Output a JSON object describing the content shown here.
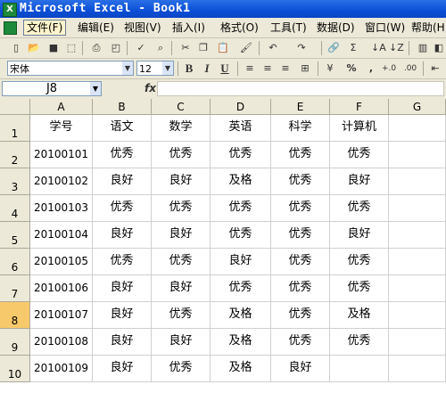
{
  "window": {
    "title": "Microsoft Excel - Book1"
  },
  "menu": [
    "文件(F)",
    "编辑(E)",
    "视图(V)",
    "插入(I)",
    "格式(O)",
    "工具(T)",
    "数据(D)",
    "窗口(W)",
    "帮助(H)"
  ],
  "format_toolbar": {
    "font": "宋体",
    "size": "12",
    "percent": "%",
    "comma": ","
  },
  "formula_bar": {
    "name_box": "J8",
    "fx": "fx",
    "content": ""
  },
  "columns": [
    "A",
    "B",
    "C",
    "D",
    "E",
    "F",
    "G"
  ],
  "selected_row": "8",
  "rows": [
    {
      "num": "1",
      "cells": [
        "学号",
        "语文",
        "数学",
        "英语",
        "科学",
        "计算机",
        ""
      ]
    },
    {
      "num": "2",
      "cells": [
        "20100101",
        "优秀",
        "优秀",
        "优秀",
        "优秀",
        "优秀",
        ""
      ]
    },
    {
      "num": "3",
      "cells": [
        "20100102",
        "良好",
        "良好",
        "及格",
        "优秀",
        "良好",
        ""
      ]
    },
    {
      "num": "4",
      "cells": [
        "20100103",
        "优秀",
        "优秀",
        "优秀",
        "优秀",
        "优秀",
        ""
      ]
    },
    {
      "num": "5",
      "cells": [
        "20100104",
        "良好",
        "良好",
        "优秀",
        "优秀",
        "良好",
        ""
      ]
    },
    {
      "num": "6",
      "cells": [
        "20100105",
        "优秀",
        "优秀",
        "良好",
        "优秀",
        "优秀",
        ""
      ]
    },
    {
      "num": "7",
      "cells": [
        "20100106",
        "良好",
        "良好",
        "优秀",
        "优秀",
        "优秀",
        ""
      ]
    },
    {
      "num": "8",
      "cells": [
        "20100107",
        "良好",
        "优秀",
        "及格",
        "优秀",
        "及格",
        ""
      ]
    },
    {
      "num": "9",
      "cells": [
        "20100108",
        "良好",
        "良好",
        "及格",
        "优秀",
        "优秀",
        ""
      ]
    },
    {
      "num": "10",
      "cells": [
        "20100109",
        "良好",
        "优秀",
        "及格",
        "良好",
        "",
        ""
      ]
    }
  ]
}
